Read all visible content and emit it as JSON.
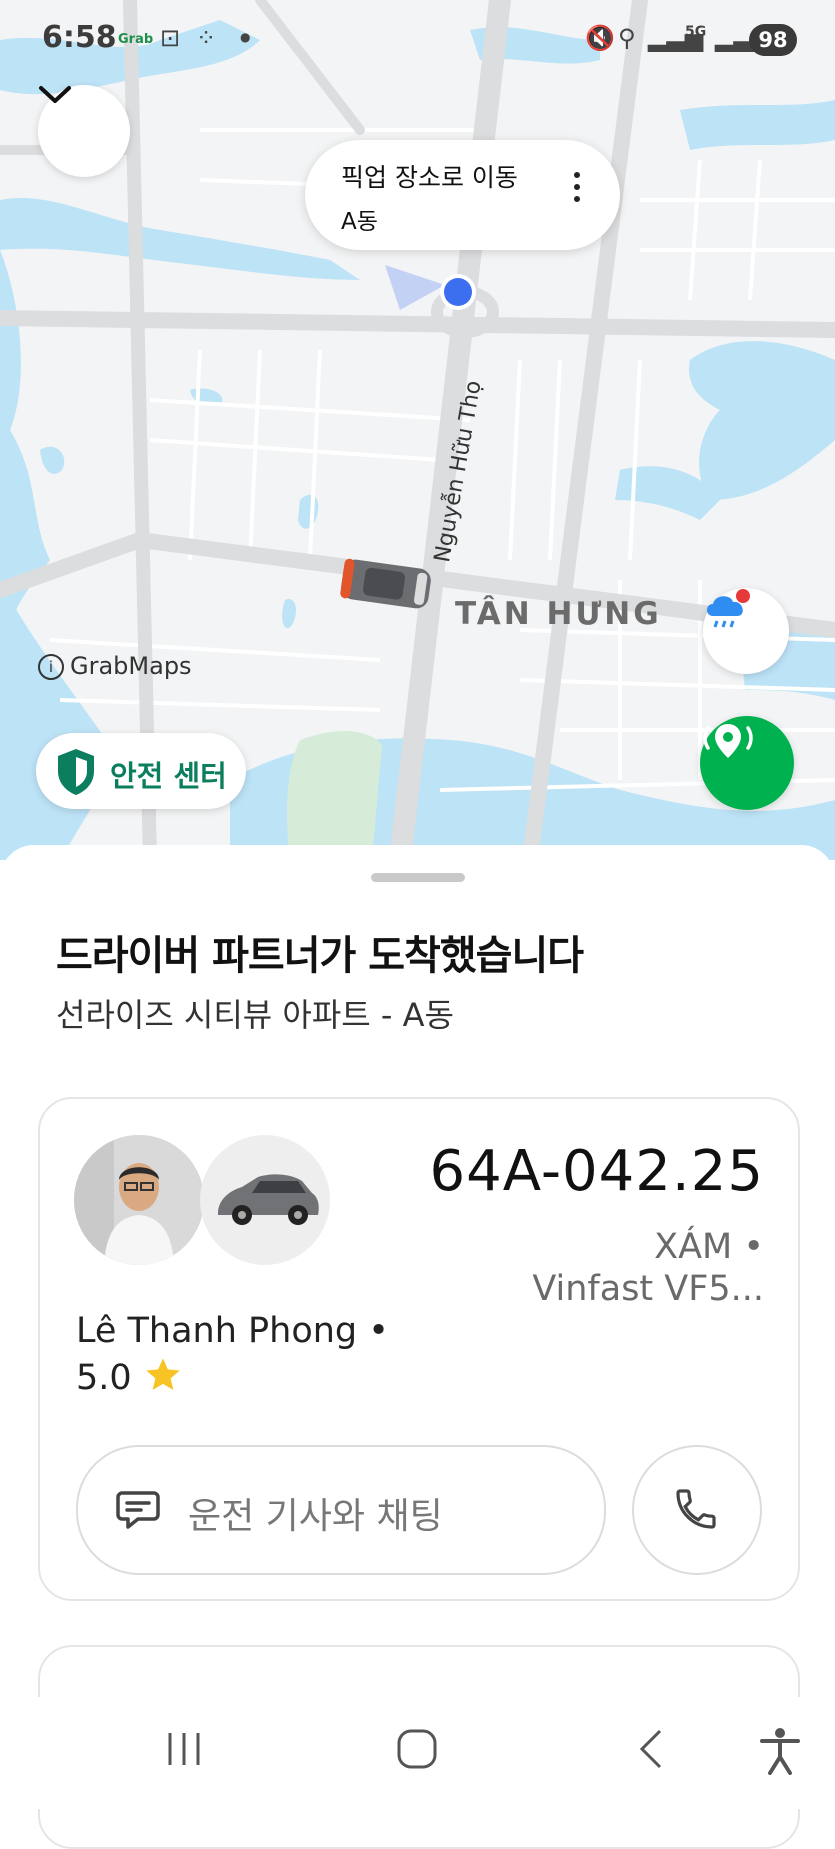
{
  "status_bar": {
    "time": "6:58",
    "app_label": "Grab",
    "battery": "98",
    "network": "5G"
  },
  "map": {
    "pickup_bubble": {
      "title": "픽업 장소로 이동",
      "subtitle": "A동"
    },
    "street_label": "Nguyễn Hữu Thọ",
    "area_label": "TÂN HƯNG",
    "attribution": "GrabMaps",
    "safety_center_label": "안전 센터"
  },
  "sheet": {
    "title": "드라이버 파트너가 도착했습니다",
    "subtitle": "선라이즈 시티뷰 아파트 - A동"
  },
  "driver": {
    "plate": "64A-042.25",
    "car_color": "XÁM •",
    "car_model": "Vinfast VF5...",
    "name": "Lê Thanh Phong •",
    "rating": "5.0",
    "chat_placeholder": "운전 기사와 채팅"
  },
  "colors": {
    "accent_green": "#00b14f",
    "safety_green": "#0a7e5e",
    "water": "#bde3f7",
    "star": "#f7c325"
  }
}
